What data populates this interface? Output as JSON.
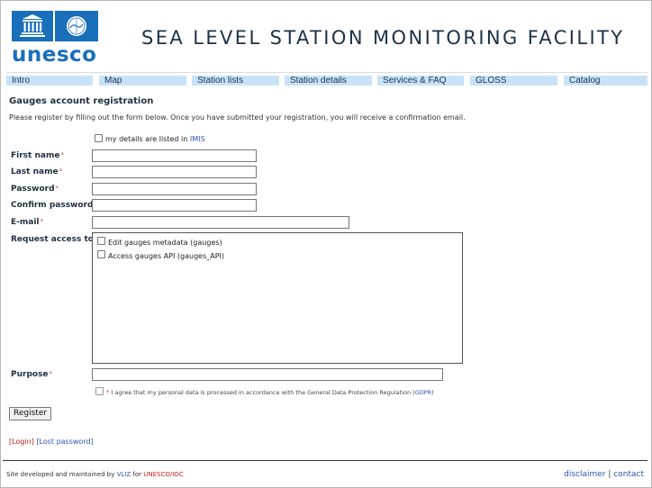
{
  "brand": {
    "logo_text": "unesco",
    "site_title": "SEA LEVEL STATION MONITORING FACILITY",
    "accent": "#1a6fba"
  },
  "nav": {
    "items": [
      "Intro",
      "Map",
      "Station lists",
      "Station details",
      "Services & FAQ",
      "GLOSS",
      "Catalog"
    ]
  },
  "form": {
    "heading": "Gauges account registration",
    "intro": "Please register by filling out the form below. Once you have submitted your registration, you will receive a confirmation email.",
    "imis_prefix": "my details are listed in",
    "imis_link": "IMIS",
    "required_mark": "*",
    "labels": {
      "first_name": "First name",
      "last_name": "Last name",
      "password": "Password",
      "confirm_password": "Confirm password",
      "email": "E-mail",
      "request_access": "Request access to",
      "purpose": "Purpose"
    },
    "access_options": [
      "Edit gauges metadata (gauges)",
      "Access gauges API (gauges_API)"
    ],
    "gdpr_text": "I agree that my personal data is processed in accordance with the General Data Protection Regulation (",
    "gdpr_link": "GDPR",
    "gdpr_end": ")",
    "register_button": "Register"
  },
  "links": {
    "login": "Login",
    "lost_password": "Lost password"
  },
  "footer": {
    "prefix": "Site developed and maintained by",
    "vliz": "VLIZ",
    "for": "for",
    "unesco_ioc": "UNESCO/IOC",
    "disclaimer": "disclaimer",
    "separator": "|",
    "contact": "contact"
  }
}
